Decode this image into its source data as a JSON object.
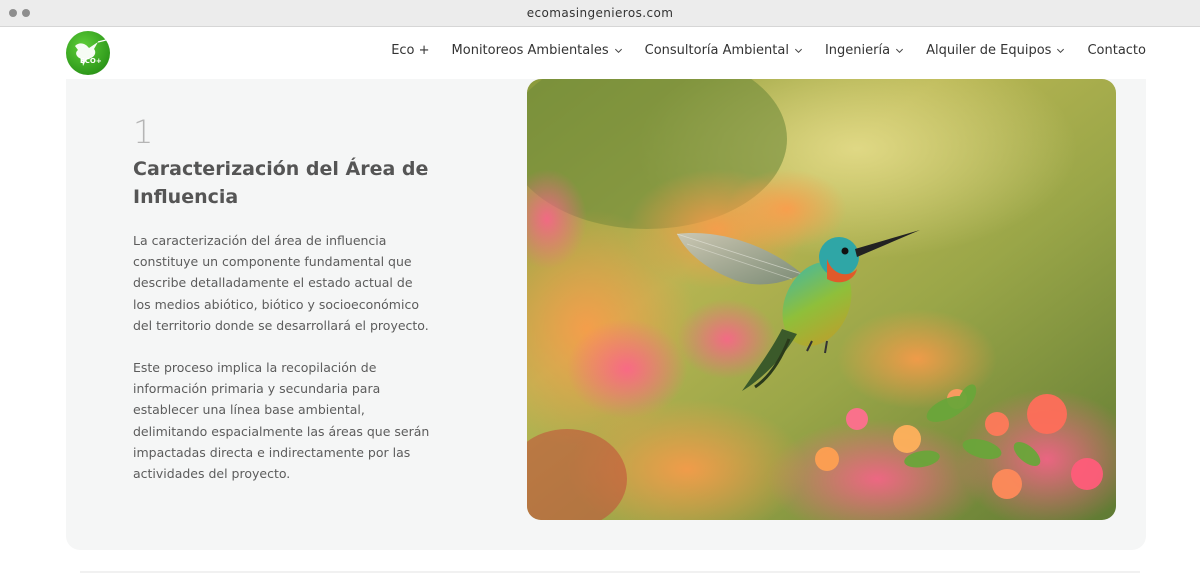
{
  "browser": {
    "url": "ecomasingenieros.com"
  },
  "logo": {
    "text": "ECO+",
    "icon": "hummingbird-icon"
  },
  "nav": {
    "items": [
      {
        "label": "Eco +",
        "dropdown": false
      },
      {
        "label": "Monitoreos Ambientales",
        "dropdown": true
      },
      {
        "label": "Consultoría Ambiental",
        "dropdown": true
      },
      {
        "label": "Ingeniería",
        "dropdown": true
      },
      {
        "label": "Alquiler de Equipos",
        "dropdown": true
      },
      {
        "label": "Contacto",
        "dropdown": false
      }
    ]
  },
  "section": {
    "number": "1",
    "title": "Caracterización del Área de Influencia",
    "paragraph1": "La caracterización del área de influencia constituye un componente fundamental que describe detalladamente el estado actual de los medios abiótico, biótico y socioeconómico del territorio donde se desarrollará el proyecto.",
    "paragraph2": "Este proceso implica la recopilación de información primaria y secundaria para establecer una línea base ambiental, delimitando espacialmente las áreas que serán impactadas directa e indirectamente por las actividades del proyecto."
  },
  "colors": {
    "brand_green": "#2f9a1b",
    "card_bg": "#f5f6f6",
    "text": "#5c5c5c"
  }
}
